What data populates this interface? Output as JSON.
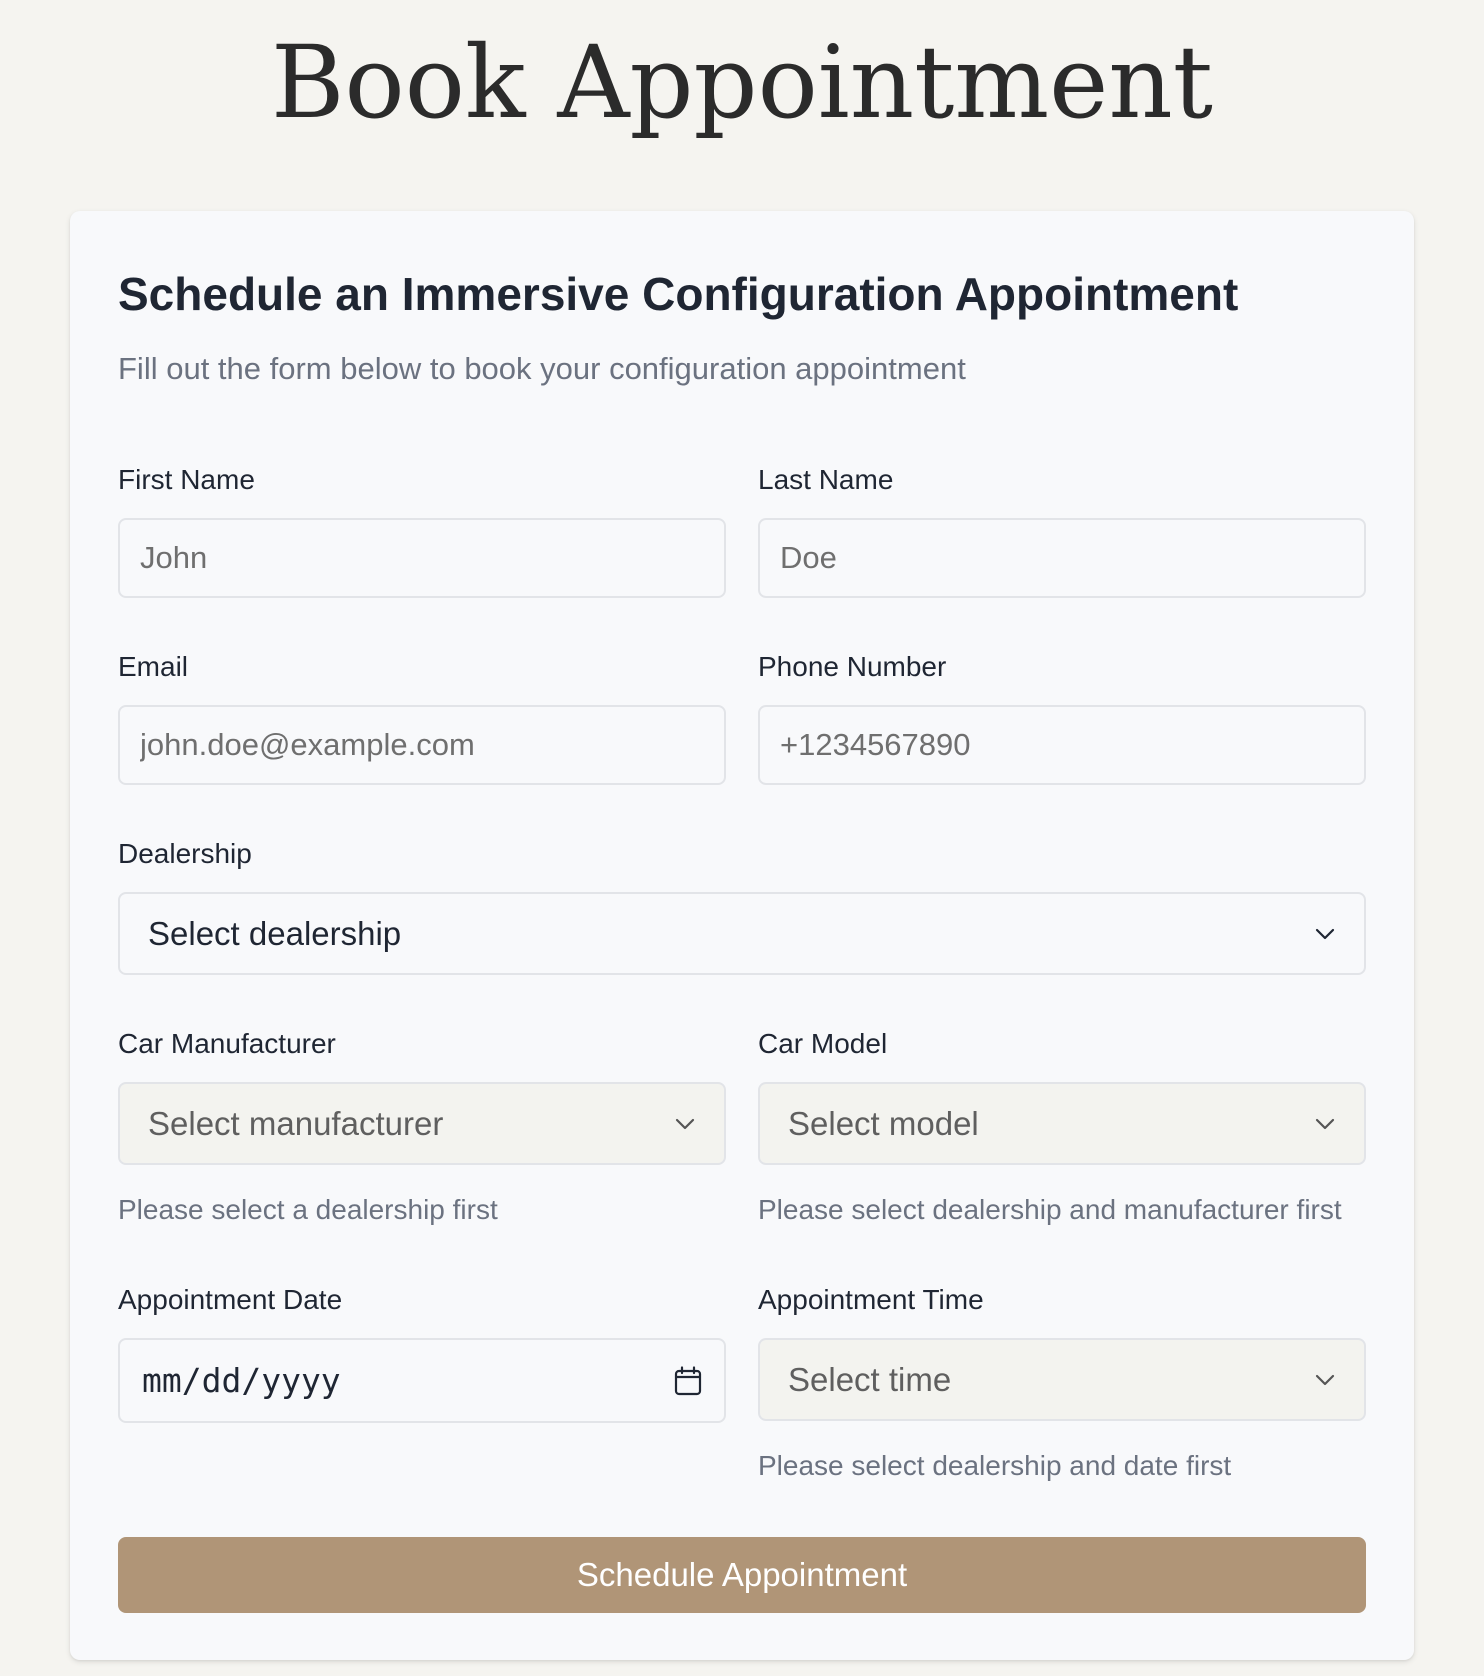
{
  "page": {
    "title": "Book Appointment"
  },
  "form": {
    "title": "Schedule an Immersive Configuration Appointment",
    "subtitle": "Fill out the form below to book your configuration appointment",
    "first_name": {
      "label": "First Name",
      "placeholder": "John",
      "value": ""
    },
    "last_name": {
      "label": "Last Name",
      "placeholder": "Doe",
      "value": ""
    },
    "email": {
      "label": "Email",
      "placeholder": "john.doe@example.com",
      "value": ""
    },
    "phone": {
      "label": "Phone Number",
      "placeholder": "+1234567890",
      "value": ""
    },
    "dealership": {
      "label": "Dealership",
      "selected": "Select dealership",
      "icon": "chevron-down-icon"
    },
    "manufacturer": {
      "label": "Car Manufacturer",
      "selected": "Select manufacturer",
      "help": "Please select a dealership first",
      "disabled": true,
      "icon": "chevron-down-icon"
    },
    "model": {
      "label": "Car Model",
      "selected": "Select model",
      "help": "Please select dealership and manufacturer first",
      "disabled": true,
      "icon": "chevron-down-icon"
    },
    "date": {
      "label": "Appointment Date",
      "placeholder": "mm/dd/yyyy",
      "icon": "calendar-icon"
    },
    "time": {
      "label": "Appointment Time",
      "selected": "Select time",
      "help": "Please select dealership and date first",
      "disabled": true,
      "icon": "chevron-down-icon"
    },
    "submit_label": "Schedule Appointment"
  },
  "colors": {
    "page_background": "#f5f4f0",
    "card_background": "#f8f9fb",
    "accent_button": "#b09577",
    "heading_text": "#1f2633",
    "muted_text": "#6b7280",
    "title_text": "#2b2b2b"
  }
}
